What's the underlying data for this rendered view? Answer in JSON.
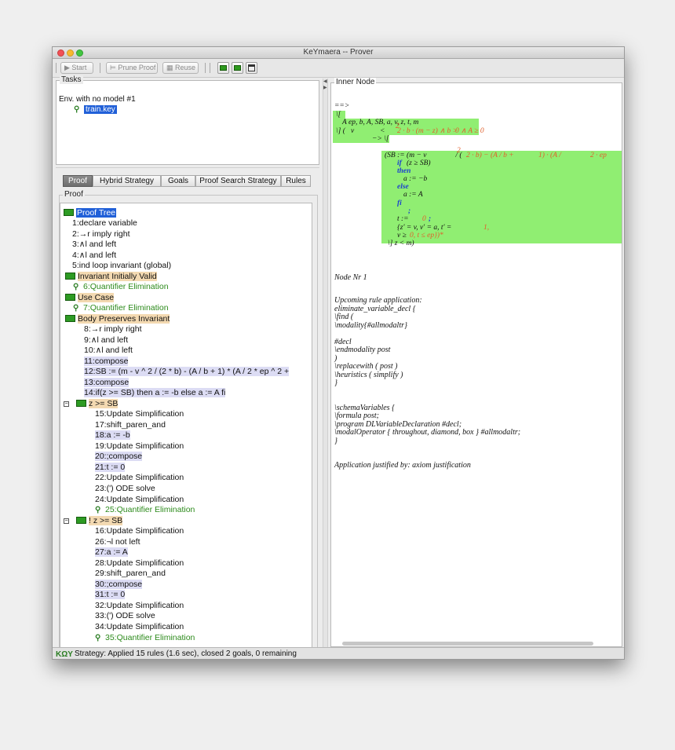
{
  "window": {
    "title": "KeYmaera -- Prover"
  },
  "toolbar": {
    "start": "Start",
    "prune": "Prune Proof",
    "reuse": "Reuse"
  },
  "tasks": {
    "label": "Tasks",
    "env": "Env. with no model #1",
    "file": "train.key"
  },
  "tabs": [
    "Proof",
    "Hybrid Strategy",
    "Goals",
    "Proof Search Strategy",
    "Rules"
  ],
  "proof_label": "Proof",
  "tree": [
    "Proof Tree",
    "1:declare variable",
    "2:→r imply right",
    "3:∧l and left",
    "4:∧l and left",
    "5:ind loop invariant (global)",
    "Invariant Initially Valid",
    "6:Quantifier Elimination",
    "Use Case",
    "7:Quantifier Elimination",
    "Body Preserves Invariant",
    "8:→r imply right",
    "9:∧l and left",
    "10:∧l and left",
    "11:compose",
    "12:SB := (m - v ^ 2 / (2 * b) - (A / b + 1) * (A / 2 * ep ^ 2 +",
    "13:compose",
    "14:if(z >= SB) then  a := -b else  a := A fi",
    "z >= SB",
    "15:Update Simplification",
    "17:shift_paren_and",
    "18:a := -b",
    "19:Update Simplification",
    "20:;compose",
    "21:t := 0",
    "22:Update Simplification",
    "23:(') ODE solve",
    "24:Update Simplification",
    "25:Quantifier Elimination",
    "! z >= SB",
    "16:Update Simplification",
    "26:¬l not left",
    "27:a := A",
    "28:Update Simplification",
    "29:shift_paren_and",
    "30:;compose",
    "31:t := 0",
    "32:Update Simplification",
    "33:(') ODE solve",
    "34:Update Simplification",
    "35:Quantifier Elimination"
  ],
  "inner": {
    "label": "Inner Node",
    "seq": [
      "==>",
      "\\[",
      "A ep, b, A, SB, a, v, z, t, m",
      "\\] (   v",
      "< ",
      "2 · b · (m − z) ∧ b > ",
      "0 ∧ A ≥ 0",
      "−> \\[",
      "(SB := (m − v",
      " / (",
      "2 · b) − (A / b + ",
      "1) · (A / ",
      "2 · ep",
      "if",
      "(z ≥ SB)",
      "then",
      "a := −b",
      "else",
      "a := A",
      "fi",
      ";",
      "t := ",
      "0",
      ";",
      "{z' = v, v' = a, t' = ",
      "1,",
      "v ≥ ",
      "0, t ≤ ep})*",
      "\\] z < m)",
      "2",
      "2"
    ],
    "node": "Node Nr 1",
    "rule_text": "Upcoming rule application:\neliminate_variable_decl {\n\\find (\n\\modality{#allmodaltr}\n\n#decl\n\\endmodality post\n)\n\\replacewith ( post )\n\\heuristics ( simplify )\n}\n\n\n\\schemaVariables {\n\\formula post;\n\\program DLVariableDeclaration #decl;\n\\modalOperator { throughout, diamond, box } #allmodaltr;\n}\n\n\nApplication justified by: axiom justification"
  },
  "status": "Strategy: Applied 15 rules (1.6 sec),  closed 2 goals, 0 remaining"
}
